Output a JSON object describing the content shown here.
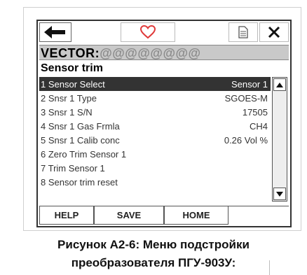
{
  "device": {
    "topbar": {
      "back_icon": "arrow-left-icon",
      "favorite_icon": "heart-icon",
      "document_icon": "document-icon",
      "close_icon": "close-icon",
      "favorite_color": "#e03a3a"
    },
    "header": {
      "prefix": "VECTOR:",
      "tag": "@@@@@@@@"
    },
    "title": "Sensor trim",
    "menu": [
      {
        "label": "1 Sensor Select",
        "value": "Sensor 1",
        "selected": true
      },
      {
        "label": "2 Snsr 1 Type",
        "value": "SGOES-M"
      },
      {
        "label": "3 Snsr 1 S/N",
        "value": "17505"
      },
      {
        "label": "4 Snsr 1 Gas Frmla",
        "value": "CH4"
      },
      {
        "label": "5 Snsr 1 Calib conc",
        "value": "0.26 Vol %"
      },
      {
        "label": "6 Zero Trim Sensor 1",
        "value": ""
      },
      {
        "label": "7 Trim Sensor 1",
        "value": ""
      },
      {
        "label": "8 Sensor trim reset",
        "value": ""
      }
    ],
    "buttons": {
      "help": "HELP",
      "save": "SAVE",
      "home": "HOME"
    }
  },
  "caption": {
    "line1": "Рисунок А2-6: Меню подстройки",
    "line2": "преобразователя ПГУ-903У:"
  }
}
